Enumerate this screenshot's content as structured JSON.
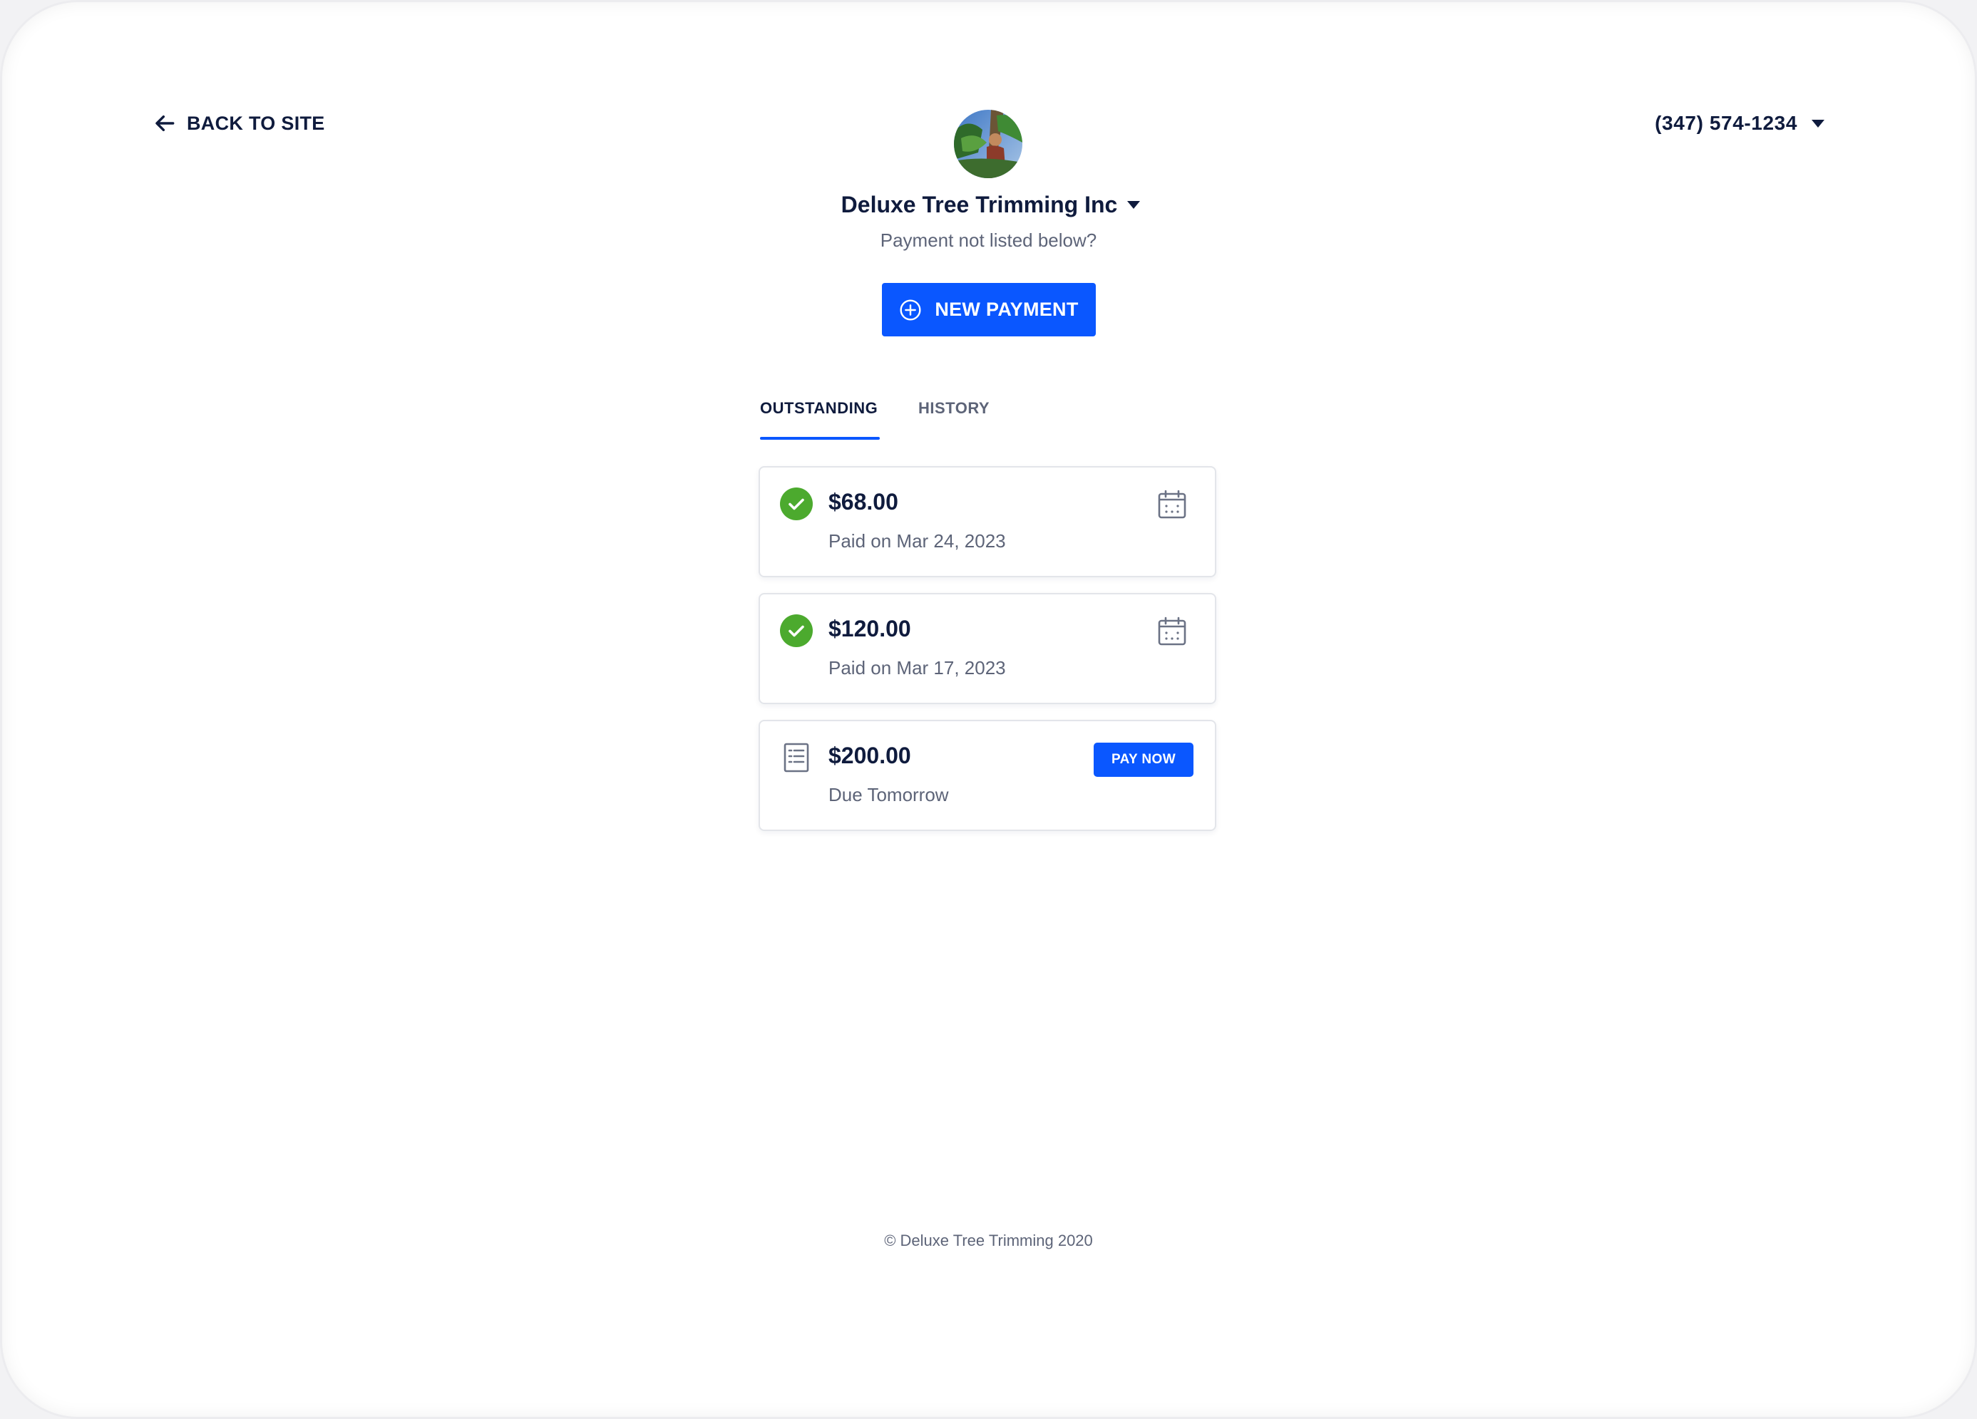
{
  "nav": {
    "back_label": "BACK TO SITE",
    "phone": "(347) 574-1234"
  },
  "merchant": {
    "name": "Deluxe Tree Trimming Inc",
    "prompt": "Payment not listed below?",
    "new_payment_label": "NEW PAYMENT"
  },
  "tabs": [
    {
      "label": "OUTSTANDING",
      "active": true
    },
    {
      "label": "HISTORY",
      "active": false
    }
  ],
  "payments": [
    {
      "amount": "$68.00",
      "detail": "Paid on Mar 24, 2023",
      "status": "paid",
      "status_icon": "check-circle-icon",
      "action_icon": "calendar-icon"
    },
    {
      "amount": "$120.00",
      "detail": "Paid on Mar 17, 2023",
      "status": "paid",
      "status_icon": "check-circle-icon",
      "action_icon": "calendar-icon"
    },
    {
      "amount": "$200.00",
      "detail": "Due Tomorrow",
      "status": "due",
      "status_icon": "invoice-icon",
      "action_label": "PAY NOW"
    }
  ],
  "footer": {
    "copyright": "© Deluxe Tree Trimming 2020"
  },
  "colors": {
    "primary": "#0a57ff",
    "navy": "#0f1b3d",
    "muted": "#5d6478",
    "success": "#4caa2e",
    "border": "#e3e5ea"
  }
}
